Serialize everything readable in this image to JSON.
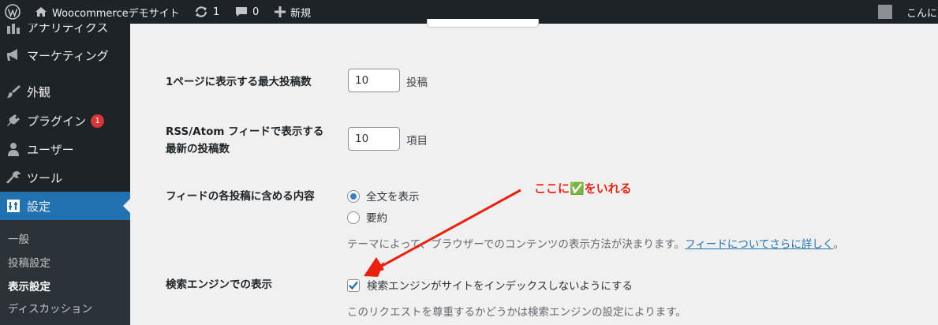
{
  "adminbar": {
    "site_name": "Woocommerceデモサイト",
    "updates_count": "1",
    "comments_count": "0",
    "new_label": "新規",
    "greeting": "こんに"
  },
  "sidebar": {
    "items": [
      {
        "label": "アナリティクス",
        "icon": "bar-chart-icon"
      },
      {
        "label": "マーケティング",
        "icon": "megaphone-icon"
      },
      {
        "label": "外観",
        "icon": "paintbrush-icon"
      },
      {
        "label": "プラグイン",
        "icon": "plug-icon",
        "badge": "1"
      },
      {
        "label": "ユーザー",
        "icon": "user-icon"
      },
      {
        "label": "ツール",
        "icon": "wrench-icon"
      },
      {
        "label": "設定",
        "icon": "settings-icon",
        "current": true
      }
    ],
    "submenu": [
      "一般",
      "投稿設定",
      "表示設定",
      "ディスカッション"
    ],
    "active_submenu": "表示設定"
  },
  "form": {
    "posts_per_page": {
      "label": "1ページに表示する最大投稿数",
      "value": "10",
      "unit": "投稿"
    },
    "posts_per_rss": {
      "label_line1": "RSS/Atom フィードで表示する",
      "label_line2": "最新の投稿数",
      "value": "10",
      "unit": "項目"
    },
    "rss_use_excerpt": {
      "label": "フィードの各投稿に含める内容",
      "options": [
        "全文を表示",
        "要約"
      ],
      "selected": "全文を表示",
      "description": "テーマによって、ブラウザーでのコンテンツの表示方法が決まります。",
      "link_text": "フィードについてさらに詳しく",
      "description_end": "。"
    },
    "blog_public": {
      "label": "検索エンジンでの表示",
      "checkbox_label": "検索エンジンがサイトをインデックスしないようにする",
      "checked": true,
      "description": "このリクエストを尊重するかどうかは検索エンジンの設定によります。"
    }
  },
  "annotation": {
    "text": "ここに✅をいれる",
    "color": "#e8200c"
  },
  "colors": {
    "admin_bg": "#1d2327",
    "accent": "#2271b1",
    "badge": "#d63638"
  }
}
